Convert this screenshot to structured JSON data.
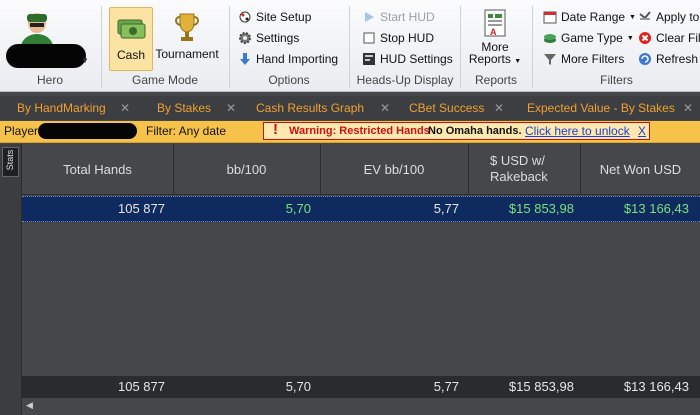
{
  "ribbon": {
    "hero": {
      "label": "Hero"
    },
    "game_mode": {
      "cash_label": "Cash",
      "tournament_label": "Tournament",
      "label": "Game Mode"
    },
    "options": {
      "site_setup": "Site Setup",
      "settings": "Settings",
      "hand_importing": "Hand Importing",
      "label": "Options"
    },
    "hud": {
      "start_hud": "Start HUD",
      "stop_hud": "Stop HUD",
      "hud_settings": "HUD Settings",
      "label": "Heads-Up Display"
    },
    "reports": {
      "more_reports_line1": "More",
      "more_reports_line2": "Reports",
      "label": "Reports"
    },
    "filters": {
      "date_range": "Date Range",
      "game_type": "Game Type",
      "more_filters": "More Filters",
      "apply_to": "Apply to",
      "clear_filt": "Clear Filt",
      "refresh": "Refresh",
      "label": "Filters"
    }
  },
  "tabs": [
    "By HandMarking",
    "By Stakes",
    "Cash Results Graph",
    "CBet Success",
    "Expected Value - By Stakes"
  ],
  "filterbar": {
    "player_label": "Player",
    "filter_text": "Filter: Any date",
    "warning_title": "Warning: Restricted Hands",
    "warning_body": "No Omaha hands.",
    "unlock_link": "Click here to unlock",
    "close_x": "X"
  },
  "grid": {
    "side_label": "Stats",
    "columns": [
      "Total Hands",
      "bb/100",
      "EV bb/100",
      "$ USD w/ Rakeback",
      "Net Won USD"
    ],
    "row": [
      "105 877",
      "5,70",
      "5,77",
      "$15 853,98",
      "$13 166,43"
    ],
    "totals": [
      "105 877",
      "5,70",
      "5,77",
      "$15 853,98",
      "$13 166,43"
    ]
  },
  "colors": {
    "accent_tab": "#f0a030",
    "filter_bg": "#f7c24a",
    "positive": "#7de07d",
    "warning_red": "#d01010"
  }
}
